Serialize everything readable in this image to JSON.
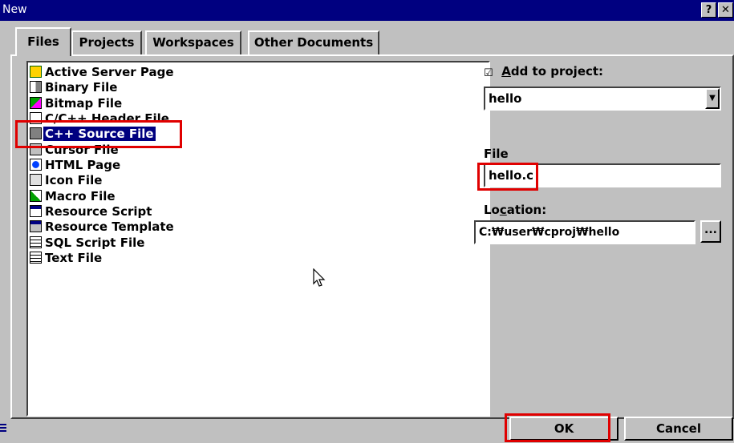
{
  "window": {
    "title": "New",
    "help_label": "?",
    "close_label": "✕"
  },
  "tabs": [
    {
      "label": "Files",
      "active": true
    },
    {
      "label": "Projects",
      "active": false
    },
    {
      "label": "Workspaces",
      "active": false
    },
    {
      "label": "Other Documents",
      "active": false
    }
  ],
  "file_types": [
    {
      "label": "Active Server Page",
      "icon": "active-server-page-icon"
    },
    {
      "label": "Binary File",
      "icon": "binary-file-icon"
    },
    {
      "label": "Bitmap File",
      "icon": "bitmap-file-icon"
    },
    {
      "label": "C/C++ Header File",
      "icon": "header-file-icon"
    },
    {
      "label": "C++ Source File",
      "icon": "cpp-source-file-icon",
      "selected": true
    },
    {
      "label": "Cursor File",
      "icon": "cursor-file-icon"
    },
    {
      "label": "HTML Page",
      "icon": "html-page-icon"
    },
    {
      "label": "Icon File",
      "icon": "icon-file-icon"
    },
    {
      "label": "Macro File",
      "icon": "macro-file-icon"
    },
    {
      "label": "Resource Script",
      "icon": "resource-script-icon"
    },
    {
      "label": "Resource Template",
      "icon": "resource-template-icon"
    },
    {
      "label": "SQL Script File",
      "icon": "sql-script-file-icon"
    },
    {
      "label": "Text File",
      "icon": "text-file-icon"
    }
  ],
  "add_to_project": {
    "checked": true,
    "label": "Add to project:",
    "hotkey": "A",
    "label_rest": "dd to project:"
  },
  "project_select": {
    "value": "hello",
    "arrow": "▼"
  },
  "file_field": {
    "label": "File",
    "value": "hello.c"
  },
  "location_field": {
    "label_pre": "Lo",
    "hotkey": "c",
    "label_post": "ation:",
    "value": "C:₩user₩cproj₩hello",
    "browse_label": "..."
  },
  "buttons": {
    "ok": "OK",
    "cancel": "Cancel"
  },
  "colors": {
    "highlight_box": "#e00000",
    "selection": "#000080",
    "title_bar": "#000080",
    "face": "#c0c0c0"
  }
}
